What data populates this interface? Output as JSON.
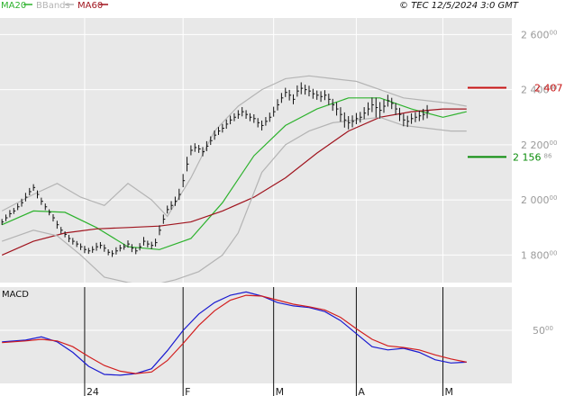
{
  "header": {
    "legend": [
      {
        "label": "MA20",
        "color": "#2db22d"
      },
      {
        "label": "BBands",
        "color": "#b4b4b4"
      },
      {
        "label": "MA60",
        "color": "#a0141e"
      }
    ],
    "stamp": "© TEC 12/5/2024 3:0 GMT"
  },
  "colors": {
    "panel_bg": "#e8e8e8",
    "grid": "#ffffff",
    "ma20": "#2db22d",
    "ma60": "#a0141e",
    "bbands": "#b4b4b4",
    "bars": "#111111",
    "macd": "#1a1ad0",
    "signal": "#d21e1e"
  },
  "chart_data": [
    {
      "type": "line",
      "panel": "price",
      "y_ticks": [
        {
          "main": "2 600",
          "sub": "00",
          "value": 2600
        },
        {
          "main": "2 400",
          "sub": "00",
          "value": 2400
        },
        {
          "main": "2 200",
          "sub": "00",
          "value": 2200
        },
        {
          "main": "2 000",
          "sub": "00",
          "value": 2000
        },
        {
          "main": "1 800",
          "sub": "00",
          "value": 1800
        }
      ],
      "ylim": [
        1700,
        2660
      ],
      "x_count": 130,
      "x_labels": [
        {
          "label": "24",
          "index": 21
        },
        {
          "label": "F",
          "index": 46
        },
        {
          "label": "M",
          "index": 69
        },
        {
          "label": "A",
          "index": 90
        },
        {
          "label": "M",
          "index": 112
        }
      ],
      "levels": [
        {
          "main": "2 407",
          "sub": "1",
          "value": 2407,
          "color": "#c81414"
        },
        {
          "main": "2 156",
          "sub": "86",
          "value": 2156,
          "color": "#0a8c0a"
        }
      ],
      "series": [
        {
          "name": "MA20",
          "key": "ma20",
          "x": [
            0,
            8,
            16,
            24,
            32,
            40,
            48,
            56,
            64,
            72,
            80,
            88,
            96,
            104,
            112,
            118
          ],
          "y": [
            1910,
            1960,
            1955,
            1900,
            1830,
            1820,
            1860,
            1990,
            2160,
            2270,
            2330,
            2370,
            2370,
            2330,
            2300,
            2320
          ]
        },
        {
          "name": "MA60",
          "key": "ma60",
          "x": [
            0,
            8,
            16,
            24,
            32,
            40,
            48,
            56,
            64,
            72,
            80,
            88,
            96,
            104,
            112,
            118
          ],
          "y": [
            1800,
            1850,
            1880,
            1895,
            1900,
            1905,
            1920,
            1960,
            2010,
            2080,
            2170,
            2250,
            2300,
            2320,
            2330,
            2330
          ]
        },
        {
          "name": "BBands upper",
          "key": "bb_upper",
          "x": [
            0,
            8,
            14,
            20,
            26,
            32,
            38,
            42,
            48,
            54,
            60,
            66,
            72,
            78,
            84,
            90,
            96,
            102,
            108,
            114,
            118
          ],
          "y": [
            1960,
            2020,
            2060,
            2010,
            1980,
            2060,
            2000,
            1940,
            2080,
            2250,
            2340,
            2400,
            2440,
            2450,
            2440,
            2430,
            2400,
            2370,
            2360,
            2350,
            2340
          ]
        },
        {
          "name": "BBands lower",
          "key": "bb_lower",
          "x": [
            0,
            8,
            14,
            20,
            26,
            32,
            38,
            44,
            50,
            56,
            60,
            66,
            72,
            78,
            84,
            90,
            96,
            102,
            108,
            114,
            118
          ],
          "y": [
            1850,
            1890,
            1870,
            1800,
            1720,
            1700,
            1690,
            1710,
            1740,
            1800,
            1880,
            2100,
            2200,
            2250,
            2280,
            2290,
            2300,
            2270,
            2260,
            2250,
            2250
          ]
        }
      ],
      "bars_close": [
        1920,
        1935,
        1950,
        1960,
        1975,
        1990,
        2010,
        2030,
        2045,
        2020,
        1995,
        1975,
        1955,
        1935,
        1910,
        1890,
        1875,
        1860,
        1850,
        1840,
        1830,
        1820,
        1815,
        1820,
        1830,
        1835,
        1825,
        1810,
        1805,
        1815,
        1825,
        1830,
        1840,
        1825,
        1815,
        1830,
        1850,
        1840,
        1835,
        1845,
        1890,
        1930,
        1965,
        1980,
        1995,
        2020,
        2070,
        2130,
        2180,
        2190,
        2185,
        2175,
        2195,
        2215,
        2235,
        2250,
        2260,
        2275,
        2290,
        2300,
        2310,
        2320,
        2310,
        2300,
        2295,
        2280,
        2270,
        2285,
        2300,
        2320,
        2345,
        2370,
        2390,
        2380,
        2365,
        2395,
        2405,
        2400,
        2395,
        2385,
        2380,
        2375,
        2380,
        2365,
        2345,
        2330,
        2310,
        2290,
        2280,
        2285,
        2295,
        2300,
        2315,
        2330,
        2345,
        2335,
        2325,
        2340,
        2360,
        2350,
        2330,
        2310,
        2290,
        2285,
        2295,
        2300,
        2305,
        2310,
        2320
      ],
      "bars_range": [
        18,
        20,
        22,
        18,
        20,
        24,
        26,
        22,
        20,
        24,
        22,
        20,
        18,
        22,
        24,
        20,
        18,
        22,
        20,
        18,
        20,
        22,
        18,
        20,
        24,
        20,
        22,
        18,
        20,
        22,
        20,
        18,
        22,
        24,
        20,
        22,
        26,
        20,
        22,
        24,
        30,
        28,
        24,
        26,
        28,
        34,
        40,
        44,
        30,
        26,
        24,
        28,
        30,
        26,
        28,
        24,
        26,
        28,
        26,
        24,
        26,
        28,
        26,
        24,
        26,
        28,
        30,
        26,
        28,
        30,
        34,
        30,
        28,
        32,
        30,
        34,
        36,
        30,
        32,
        30,
        28,
        32,
        30,
        34,
        36,
        40,
        44,
        46,
        40,
        36,
        34,
        32,
        36,
        40,
        44,
        60,
        50,
        40,
        36,
        34,
        36,
        40,
        38,
        34,
        32,
        30,
        32,
        34,
        40
      ],
      "bars_start_index": 0
    },
    {
      "type": "line",
      "panel": "macd",
      "title": "MACD",
      "y_ticks": [
        {
          "label": "50",
          "sub": "00",
          "value": 5000
        }
      ],
      "ylim": [
        -1500,
        10300
      ],
      "series": [
        {
          "name": "MACD",
          "key": "macd",
          "x": [
            0,
            6,
            10,
            14,
            18,
            22,
            26,
            30,
            34,
            38,
            42,
            46,
            50,
            54,
            58,
            62,
            66,
            70,
            74,
            78,
            82,
            86,
            90,
            94,
            98,
            102,
            106,
            110,
            114,
            118
          ],
          "y": [
            3600,
            3800,
            4200,
            3600,
            2300,
            600,
            -400,
            -500,
            -300,
            300,
            2500,
            5000,
            7000,
            8400,
            9300,
            9700,
            9200,
            8400,
            8000,
            7800,
            7300,
            6200,
            4600,
            3000,
            2600,
            2800,
            2300,
            1400,
            1000,
            1100
          ]
        },
        {
          "name": "Signal",
          "key": "signal",
          "x": [
            0,
            6,
            10,
            14,
            18,
            22,
            26,
            30,
            34,
            38,
            42,
            46,
            50,
            54,
            58,
            62,
            66,
            70,
            74,
            78,
            82,
            86,
            90,
            94,
            98,
            102,
            106,
            110,
            114,
            118
          ],
          "y": [
            3500,
            3700,
            3900,
            3700,
            3000,
            1800,
            700,
            0,
            -300,
            -100,
            1300,
            3400,
            5600,
            7400,
            8700,
            9300,
            9200,
            8700,
            8200,
            7900,
            7500,
            6600,
            5200,
            3900,
            3100,
            2900,
            2600,
            2000,
            1500,
            1100
          ]
        }
      ]
    }
  ]
}
